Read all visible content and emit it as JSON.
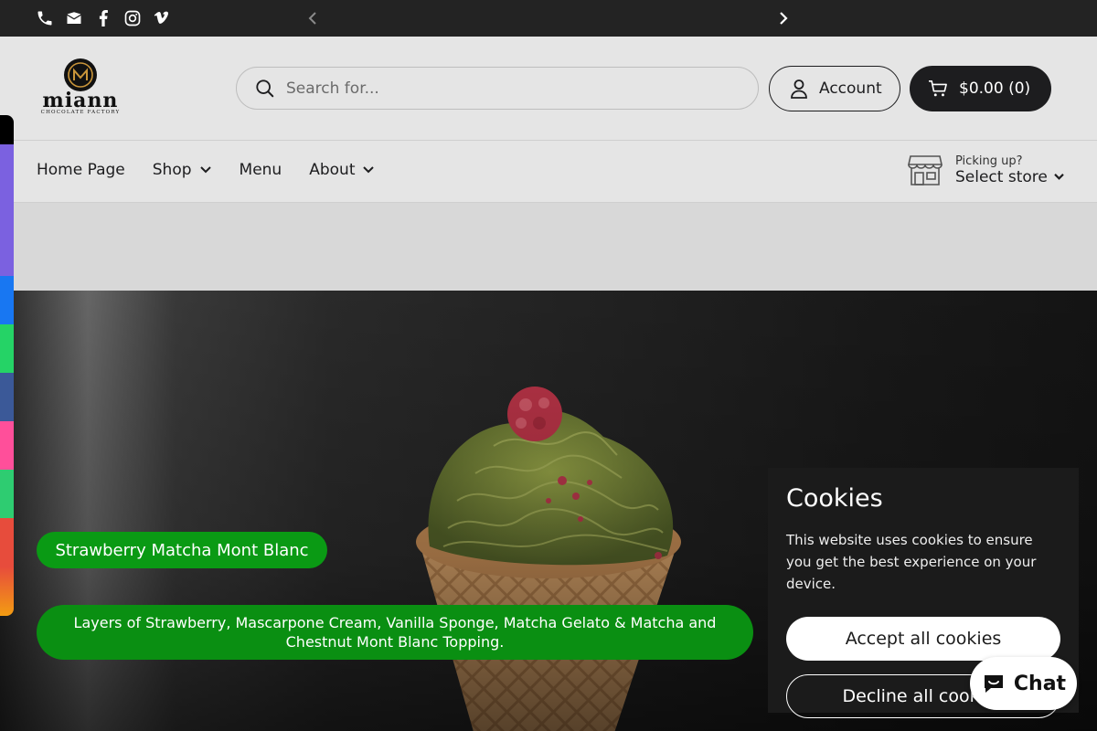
{
  "topbar": {
    "icons": [
      "phone-icon",
      "email-icon",
      "facebook-icon",
      "instagram-icon",
      "vimeo-icon"
    ],
    "prev_icon": "chevron-left-icon",
    "next_icon": "chevron-right-icon"
  },
  "header": {
    "logo_text": "miann",
    "logo_subtext": "CHOCOLATE FACTORY",
    "search_placeholder": "Search for...",
    "account_label": "Account",
    "cart_label": "$0.00 (0)"
  },
  "nav": {
    "items": [
      {
        "label": "Home Page",
        "has_dropdown": false
      },
      {
        "label": "Shop",
        "has_dropdown": true
      },
      {
        "label": "Menu",
        "has_dropdown": false
      },
      {
        "label": "About",
        "has_dropdown": true
      }
    ]
  },
  "store": {
    "small_label": "Picking up?",
    "select_label": "Select store"
  },
  "hero": {
    "title": "Strawberry Matcha Mont Blanc",
    "description": "Layers of Strawberry, Mascarpone Cream, Vanilla Sponge, Matcha Gelato & Matcha and Chestnut Mont Blanc Topping.",
    "accent_color": "#0a9a14"
  },
  "cookies": {
    "title": "Cookies",
    "text": "This website uses cookies to ensure you get the best experience on your device.",
    "accept_label": "Accept all cookies",
    "decline_label": "Decline all cookies"
  },
  "chat": {
    "label": "Chat"
  },
  "side_strip_colors": [
    "#000000",
    "#7b61e0",
    "#1877f2",
    "#25d366",
    "#3b5998",
    "#ff4f9a",
    "#2ecc71",
    "#e74c3c",
    "#f39c12"
  ]
}
